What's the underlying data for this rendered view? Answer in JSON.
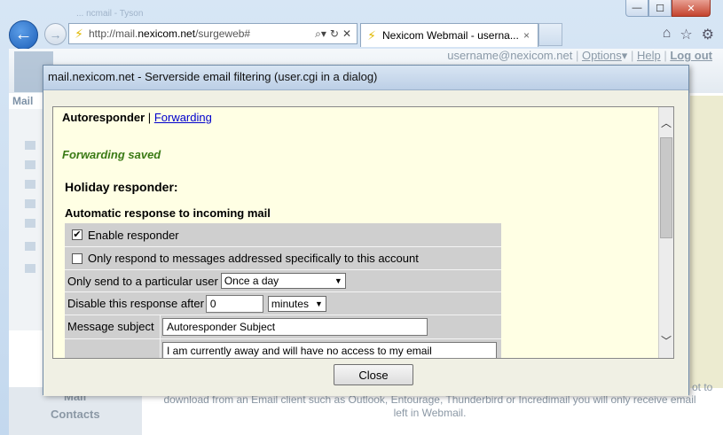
{
  "browser": {
    "ghost_title": "... ncmail - Tyson",
    "address": {
      "prefix": "http://mail.",
      "domain": "nexicom.net",
      "suffix": "/surgeweb#"
    },
    "tab_title": "Nexicom Webmail - userna...",
    "tab_close": "×",
    "window_controls": {
      "minimize": "—",
      "maximize": "☐",
      "close": "✕"
    },
    "toolbar_icons": [
      "home-icon",
      "star-icon",
      "gear-icon"
    ]
  },
  "page": {
    "user_email": "username@nexicom.net",
    "options_label": "Options",
    "help_label": "Help",
    "logout_label": "Log out",
    "mail_label": "Mail",
    "bottom_mail": "Mail",
    "bottom_contacts": "Contacts",
    "info_line1": "download from an Email client such as Outlook, Entourage, Thunderbird or Incredimail you will only receive email",
    "info_line2": "left in Webmail.",
    "info_right": "ot to"
  },
  "dialog": {
    "title": "mail.nexicom.net - Serverside email filtering (user.cgi in a dialog)",
    "tab_autoresponder": "Autoresponder",
    "tab_separator": "|",
    "tab_forwarding": "Forwarding",
    "saved_message": "Forwarding saved",
    "holiday_heading": "Holiday responder:",
    "auto_heading": "Automatic response to incoming mail",
    "enable_label": "Enable responder",
    "enable_checked": true,
    "only_respond_label": "Only respond to messages addressed specifically to this account",
    "only_respond_checked": false,
    "send_user_label": "Only send to a particular user",
    "send_user_value": "Once a day",
    "disable_label": "Disable this response after",
    "disable_value": "0",
    "disable_unit": "minutes",
    "subject_label": "Message subject",
    "subject_value": "Autoresponder Subject",
    "message_value": "I am currently away and will have no access to my email",
    "close_button": "Close"
  }
}
